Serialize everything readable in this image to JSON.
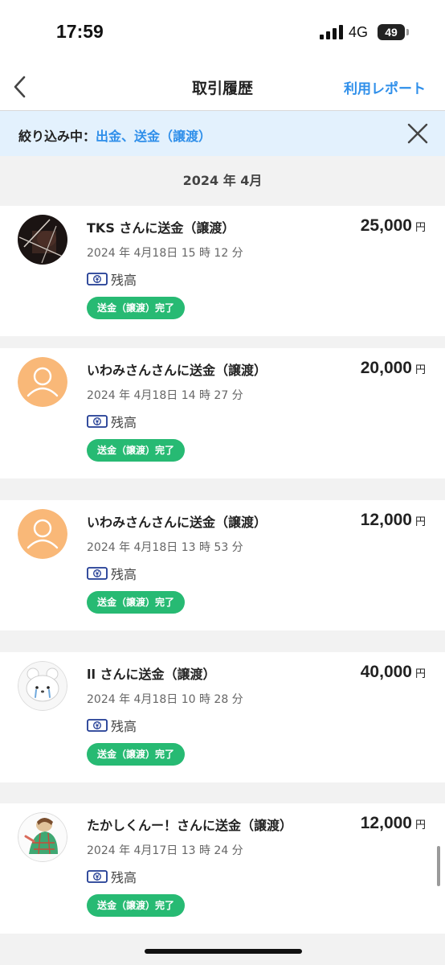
{
  "status_bar": {
    "time": "17:59",
    "network": "4G",
    "battery": "49"
  },
  "nav": {
    "title": "取引履歴",
    "report_link": "利用レポート"
  },
  "filter": {
    "label": "絞り込み中：",
    "value": "出金、送金（譲渡）"
  },
  "month_header": "2024 年 4月",
  "transactions": [
    {
      "title": "TKS さんに送金（譲渡）",
      "datetime": "2024 年 4月18日 15 時 12 分",
      "method": "残高",
      "status": "送金（譲渡）完了",
      "amount": "25,000",
      "unit": "円",
      "avatar": "photo-dark"
    },
    {
      "title": "いわみさんさんに送金（譲渡）",
      "datetime": "2024 年 4月18日 14 時 27 分",
      "method": "残高",
      "status": "送金（譲渡）完了",
      "amount": "20,000",
      "unit": "円",
      "avatar": "default-user"
    },
    {
      "title": "いわみさんさんに送金（譲渡）",
      "datetime": "2024 年 4月18日 13 時 53 分",
      "method": "残高",
      "status": "送金（譲渡）完了",
      "amount": "12,000",
      "unit": "円",
      "avatar": "default-user"
    },
    {
      "title": "ll さんに送金（譲渡）",
      "datetime": "2024 年 4月18日 10 時 28 分",
      "method": "残高",
      "status": "送金（譲渡）完了",
      "amount": "40,000",
      "unit": "円",
      "avatar": "crying-bear"
    },
    {
      "title": "たかしくんー！さんに送金（譲渡）",
      "datetime": "2024 年 4月17日 13 時 24 分",
      "method": "残高",
      "status": "送金（譲渡）完了",
      "amount": "12,000",
      "unit": "円",
      "avatar": "illustrated-character"
    }
  ],
  "colors": {
    "accent": "#2f8fea",
    "status_green": "#27ba73",
    "filter_bg": "#e3f1fd",
    "avatar_orange": "#f9b878"
  }
}
